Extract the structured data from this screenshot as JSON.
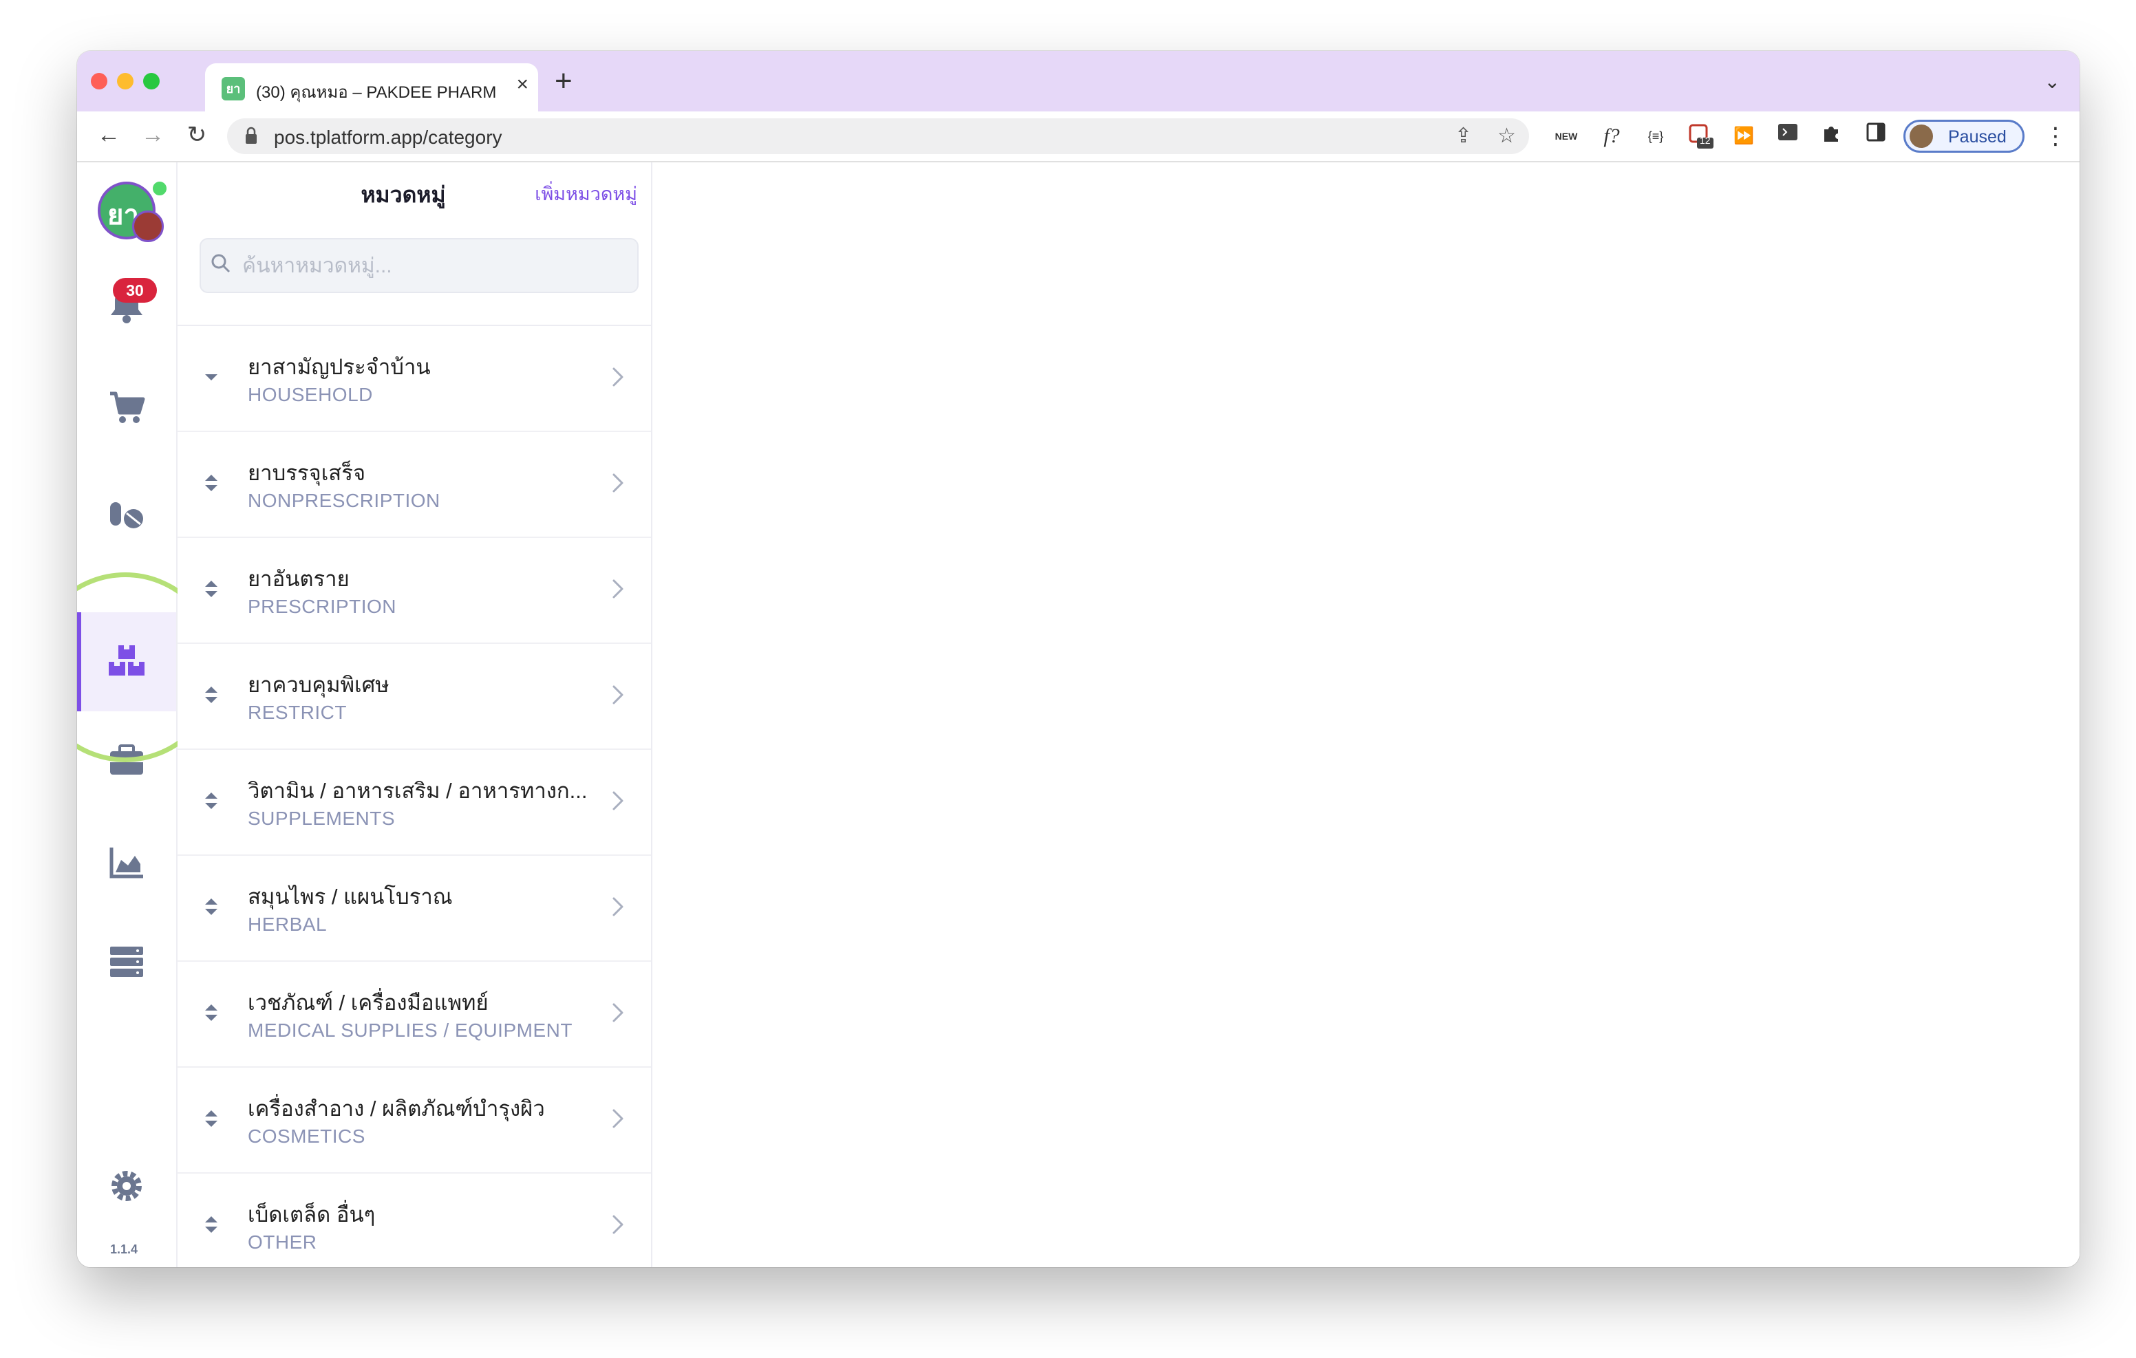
{
  "browser": {
    "tab_title": "(30) คุณหมอ – PAKDEE PHARM",
    "tab_favicon_text": "ยา",
    "url": "pos.tplatform.app/category",
    "profile_label": "Paused",
    "extension_icons": [
      "new-badge-icon",
      "f-question-icon",
      "json-braces-icon",
      "extension-badge-icon",
      "fast-forward-icon",
      "terminal-icon",
      "puzzle-icon",
      "sidebar-icon"
    ],
    "extension_badge_count": "12",
    "traffic_lights": [
      "#fe5f57",
      "#febc2e",
      "#28c840"
    ]
  },
  "rail": {
    "logo_text": "ยา",
    "notification_count": "30",
    "items": [
      "bell-icon",
      "cart-icon",
      "pills-icon",
      "category-icon",
      "briefcase-icon",
      "chart-icon",
      "server-icon"
    ],
    "active_item": "category-icon",
    "settings_icon": "gear-icon",
    "version": "1.1.4"
  },
  "panel": {
    "title": "หมวดหมู่",
    "add_label": "เพิ่มหมวดหมู่",
    "search_placeholder": "ค้นหาหมวดหมู่..."
  },
  "categories": [
    {
      "thai": "ยาสามัญประจำบ้าน",
      "eng": "HOUSEHOLD",
      "handle": "down"
    },
    {
      "thai": "ยาบรรจุเสร็จ",
      "eng": "NONPRESCRIPTION",
      "handle": "updown"
    },
    {
      "thai": "ยาอันตราย",
      "eng": "PRESCRIPTION",
      "handle": "updown"
    },
    {
      "thai": "ยาควบคุมพิเศษ",
      "eng": "RESTRICT",
      "handle": "updown"
    },
    {
      "thai": "วิตามิน / อาหารเสริม / อาหารทางก...",
      "eng": "SUPPLEMENTS",
      "handle": "updown"
    },
    {
      "thai": "สมุนไพร / แผนโบราณ",
      "eng": "HERBAL",
      "handle": "updown"
    },
    {
      "thai": "เวชภัณฑ์ / เครื่องมือแพทย์",
      "eng": "MEDICAL SUPPLIES / EQUIPMENT",
      "handle": "updown"
    },
    {
      "thai": "เครื่องสำอาง / ผลิตภัณฑ์บำรุงผิว",
      "eng": "COSMETICS",
      "handle": "updown"
    },
    {
      "thai": "เบ็ดเตล็ด อื่นๆ",
      "eng": "OTHER",
      "handle": "updown"
    }
  ],
  "colors": {
    "accent": "#7d4fe6",
    "tabstrip": "#e6d8f8",
    "rail_icon": "#6b7690",
    "category_english": "#8b93b5",
    "badge": "#d9243d",
    "highlight_ring": "#b5e077"
  }
}
